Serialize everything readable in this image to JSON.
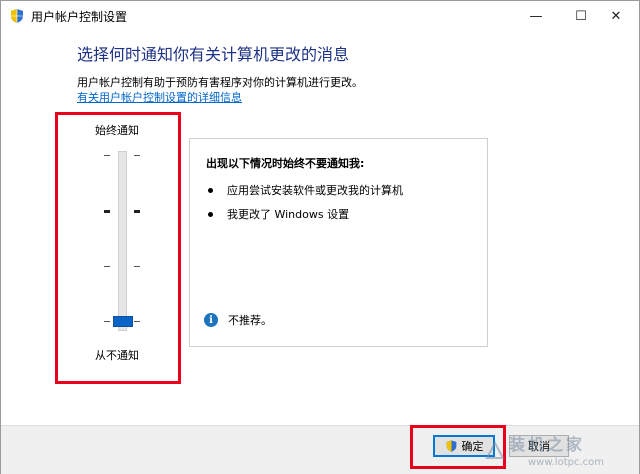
{
  "window": {
    "title": "用户帐户控制设置",
    "controls": {
      "minimize": "—",
      "maximize": "☐",
      "close": "✕"
    }
  },
  "main": {
    "heading": "选择何时通知你有关计算机更改的消息",
    "description": "用户帐户控制有助于预防有害程序对你的计算机进行更改。",
    "link": "有关用户帐户控制设置的详细信息"
  },
  "slider": {
    "top_label": "始终通知",
    "bottom_label": "从不通知",
    "levels": 4,
    "selected_level": 0
  },
  "panel": {
    "title": "出现以下情况时始终不要通知我:",
    "bullets": [
      "应用尝试安装软件或更改我的计算机",
      "我更改了 Windows 设置"
    ],
    "note": "不推荐。"
  },
  "footer": {
    "ok_label": "确定",
    "cancel_label": "取消"
  },
  "watermark": {
    "text": "装机之家",
    "url": "www.lotpc.com"
  },
  "colors": {
    "heading": "#1e3287",
    "link": "#0066cc",
    "highlight": "#e8001c",
    "thumb": "#0a64c8"
  }
}
